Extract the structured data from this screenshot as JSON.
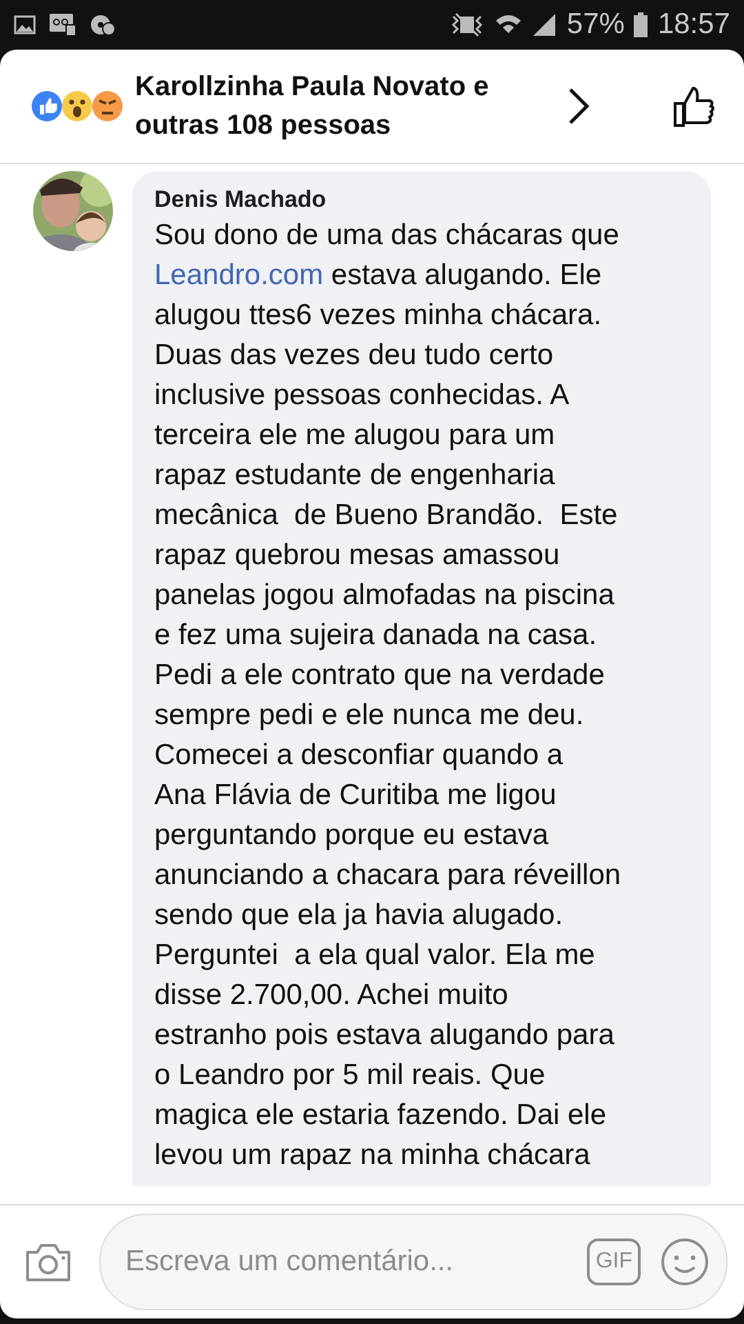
{
  "status_bar": {
    "battery": "57%",
    "time": "18:57"
  },
  "header": {
    "reactors": "Karollzinha Paula Novato e outras 108 pessoas"
  },
  "comment": {
    "author": "Denis Machado",
    "lines": [
      {
        "text": "Sou dono de uma das chácaras que"
      },
      {
        "link": "Leandro.com",
        "text": " estava alugando. Ele"
      },
      {
        "text": "alugou ttes6 vezes minha chácara."
      },
      {
        "text": "Duas das vezes deu tudo certo"
      },
      {
        "text": "inclusive pessoas conhecidas. A"
      },
      {
        "text": "terceira ele me alugou para um"
      },
      {
        "text": "rapaz estudante de engenharia"
      },
      {
        "text": "mecânica  de Bueno Brandão.  Este"
      },
      {
        "text": "rapaz quebrou mesas amassou"
      },
      {
        "text": "panelas jogou almofadas na piscina"
      },
      {
        "text": "e fez uma sujeira danada na casa."
      },
      {
        "text": "Pedi a ele contrato que na verdade"
      },
      {
        "text": "sempre pedi e ele nunca me deu."
      },
      {
        "text": "Comecei a desconfiar quando a"
      },
      {
        "text": "Ana Flávia de Curitiba me ligou"
      },
      {
        "text": "perguntando porque eu estava"
      },
      {
        "text": "anunciando a chacara para réveillon"
      },
      {
        "text": "sendo que ela ja havia alugado."
      },
      {
        "text": "Perguntei  a ela qual valor. Ela me"
      },
      {
        "text": "disse 2.700,00. Achei muito"
      },
      {
        "text": "estranho pois estava alugando para"
      },
      {
        "text": "o Leandro por 5 mil reais. Que"
      },
      {
        "text": "magica ele estaria fazendo. Dai ele"
      },
      {
        "text": "levou um rapaz na minha chácara"
      }
    ]
  },
  "composer": {
    "placeholder": "Escreva um comentário...",
    "gif": "GIF"
  }
}
